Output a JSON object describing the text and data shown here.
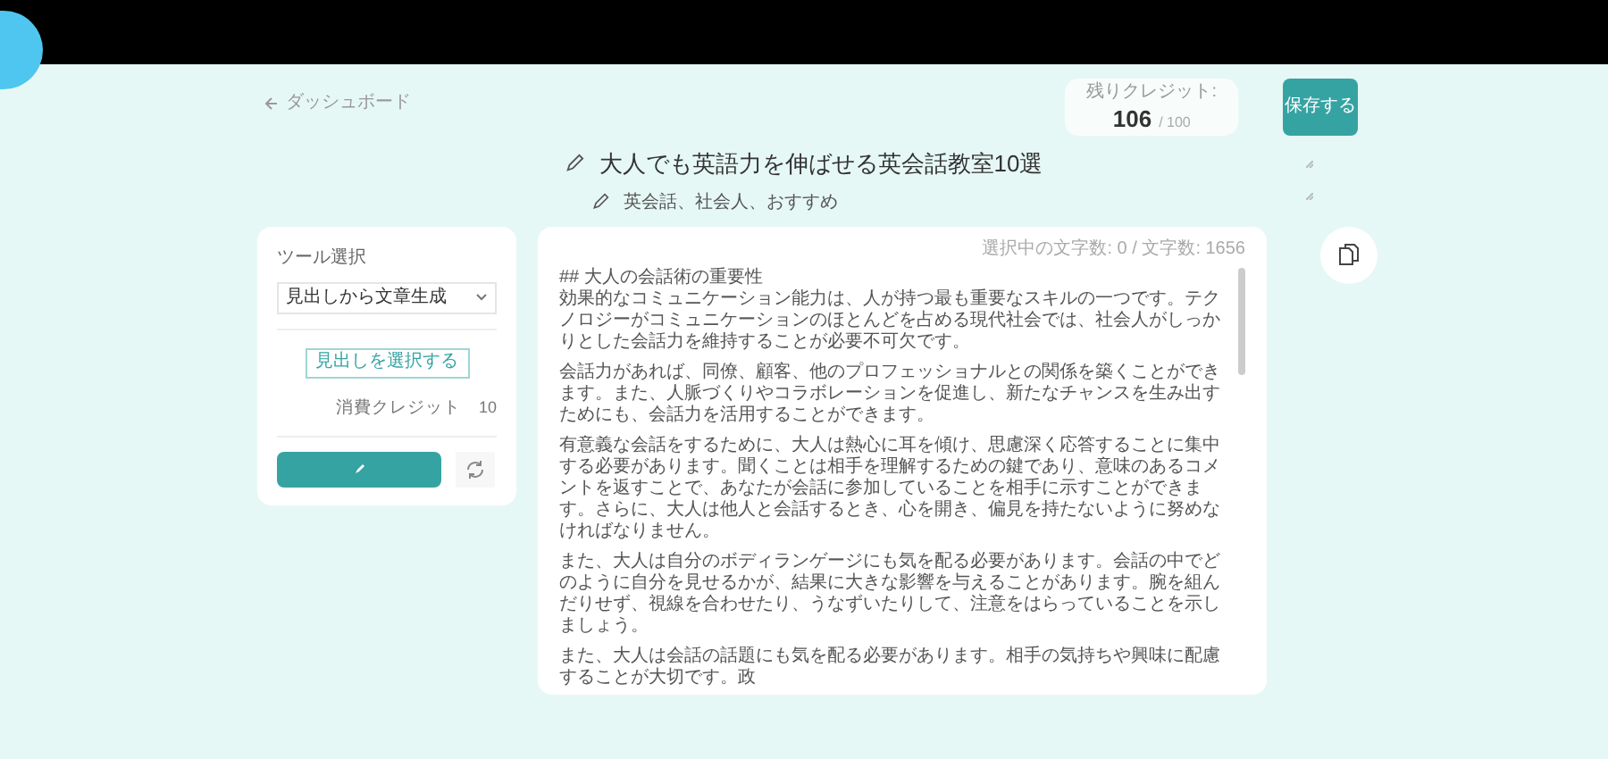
{
  "back_link": {
    "label": "ダッシュボード"
  },
  "credits": {
    "label": "残りクレジット:",
    "value": "106",
    "max": "/ 100"
  },
  "save_button": {
    "label": "保存する"
  },
  "title": "大人でも英語力を伸ばせる英会話教室10選",
  "keywords": "英会話、社会人、おすすめ",
  "tool_panel": {
    "heading": "ツール選択",
    "select": {
      "value": "見出しから文章生成"
    },
    "pick_button": "見出しを選択する",
    "cost_label": "消費クレジット",
    "cost_value": "10"
  },
  "editor": {
    "counter": "選択中の文字数: 0 / 文字数: 1656",
    "heading": "## 大人の会話術の重要性",
    "paragraphs": [
      "効果的なコミュニケーション能力は、人が持つ最も重要なスキルの一つです。テクノロジーがコミュニケーションのほとんどを占める現代社会では、社会人がしっかりとした会話力を維持することが必要不可欠です。",
      "会話力があれば、同僚、顧客、他のプロフェッショナルとの関係を築くことができます。また、人脈づくりやコラボレーションを促進し、新たなチャンスを生み出すためにも、会話力を活用することができます。",
      "有意義な会話をするために、大人は熱心に耳を傾け、思慮深く応答することに集中する必要があります。聞くことは相手を理解するための鍵であり、意味のあるコメントを返すことで、あなたが会話に参加していることを相手に示すことができます。さらに、大人は他人と会話するとき、心を開き、偏見を持たないように努めなければなりません。",
      "また、大人は自分のボディランゲージにも気を配る必要があります。会話の中でどのように自分を見せるかが、結果に大きな影響を与えることがあります。腕を組んだりせず、視線を合わせたり、うなずいたりして、注意をはらっていることを示しましょう。",
      "また、大人は会話の話題にも気を配る必要があります。相手の気持ちや興味に配慮することが大切です。政"
    ]
  }
}
